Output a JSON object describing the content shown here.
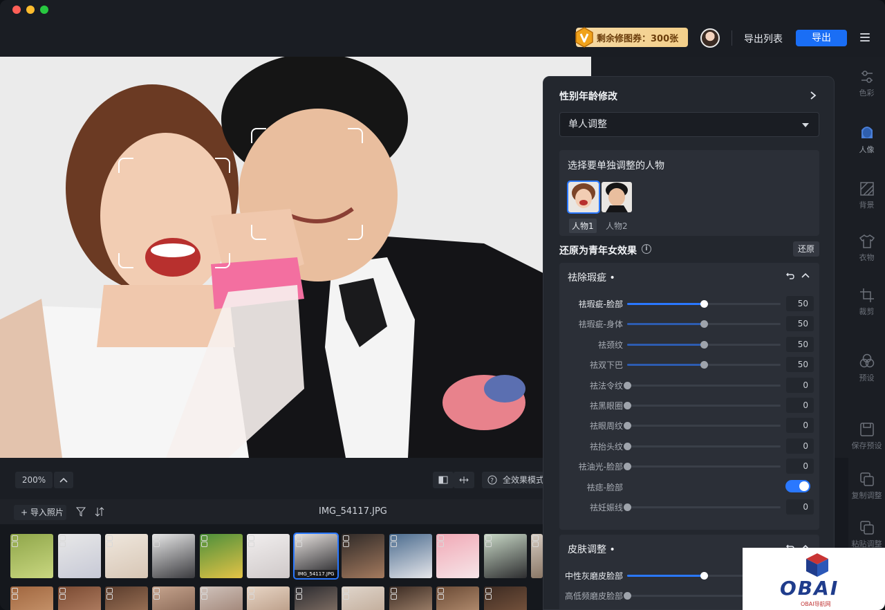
{
  "topbar": {
    "coupon_text": "剩余修图券：300张",
    "export_list": "导出列表",
    "export": "导出"
  },
  "viewbar": {
    "zoom": "200%",
    "mode": "全效果模式"
  },
  "filmbar": {
    "import": "+ 导入照片",
    "filename": "IMG_54117.JPG",
    "selected_thumb": "IMG_54117.JPG",
    "selected_count": "7"
  },
  "rail": [
    {
      "label": "色彩",
      "icon": "color-sliders-icon"
    },
    {
      "label": "人像",
      "icon": "portrait-icon"
    },
    {
      "label": "背景",
      "icon": "background-icon"
    },
    {
      "label": "衣物",
      "icon": "clothing-icon"
    },
    {
      "label": "裁剪",
      "icon": "crop-icon"
    },
    {
      "label": "预设",
      "icon": "presets-icon"
    },
    {
      "label": "保存预设",
      "icon": "save-preset-icon"
    },
    {
      "label": "复制调整",
      "icon": "copy-adjust-icon"
    },
    {
      "label": "粘贴调整",
      "icon": "paste-adjust-icon"
    }
  ],
  "panel": {
    "title": "性别年龄修改",
    "select_value": "单人调整",
    "person_header": "选择要单独调整的人物",
    "persons": [
      "人物1",
      "人物2"
    ],
    "restore_title": "还原为青年女效果",
    "restore_button": "还原",
    "sections": [
      {
        "title": "祛除瑕疵 •",
        "rows": [
          {
            "label": "祛瑕疵-脸部",
            "value": 50,
            "active": true
          },
          {
            "label": "祛瑕疵-身体",
            "value": 50
          },
          {
            "label": "祛颈纹",
            "value": 50
          },
          {
            "label": "祛双下巴",
            "value": 50
          },
          {
            "label": "祛法令纹",
            "value": 0
          },
          {
            "label": "祛黑眼圈",
            "value": 0
          },
          {
            "label": "祛眼周纹",
            "value": 0
          },
          {
            "label": "祛抬头纹",
            "value": 0
          },
          {
            "label": "祛油光-脸部",
            "value": 0
          },
          {
            "label": "祛痣-脸部",
            "toggle": true
          },
          {
            "label": "祛妊娠线",
            "value": 0
          }
        ]
      },
      {
        "title": "皮肤调整 •",
        "rows": [
          {
            "label": "中性灰磨皮脸部",
            "value": 50,
            "active": true
          },
          {
            "label": "高低频磨皮脸部",
            "value": 0
          }
        ]
      }
    ]
  },
  "watermark": {
    "text": "OBAI",
    "sub": "OBAI导航网"
  },
  "colors": {
    "accent": "#2a78ff",
    "panel": "#23272e",
    "coupon": "#f3cf8a"
  }
}
